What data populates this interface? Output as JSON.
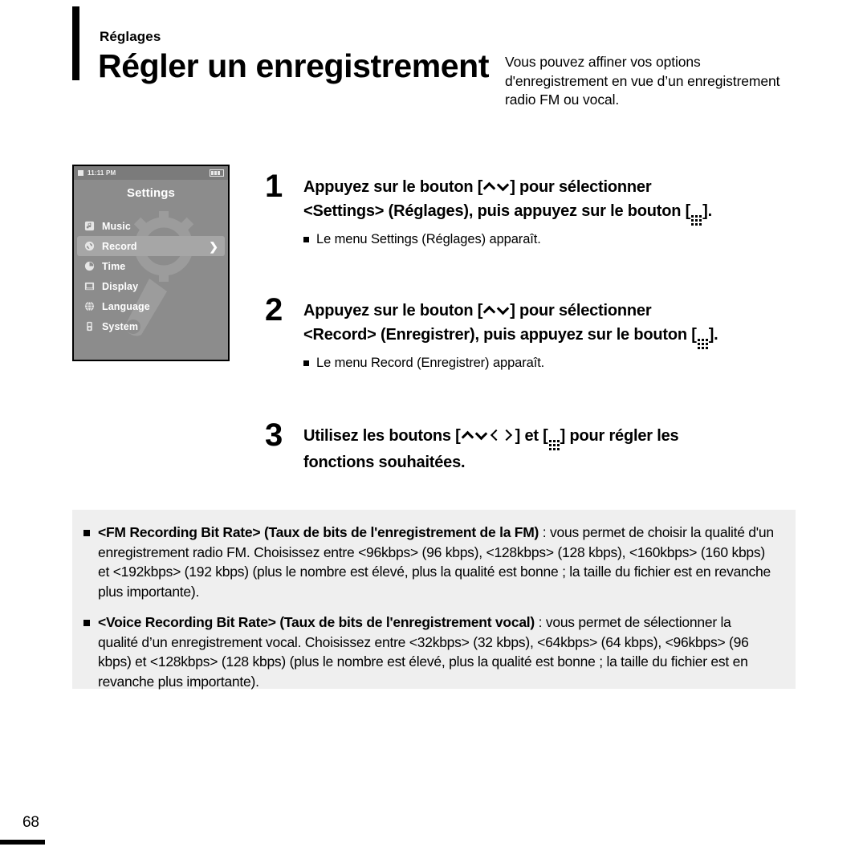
{
  "header": {
    "kicker": "Réglages",
    "title": "Régler un enregistrement",
    "description": "Vous pouvez affiner vos options d'enregistrement en vue d’un enregistrement radio FM ou vocal."
  },
  "device": {
    "status": {
      "time": "11:11 PM",
      "battery_icon": "battery-icon",
      "indicator_icon": "square-indicator-icon"
    },
    "title": "Settings",
    "menu": [
      {
        "label": "Music",
        "icon": "music-note-icon",
        "selected": false
      },
      {
        "label": "Record",
        "icon": "record-icon",
        "selected": true
      },
      {
        "label": "Time",
        "icon": "clock-icon",
        "selected": false
      },
      {
        "label": "Display",
        "icon": "display-icon",
        "selected": false
      },
      {
        "label": "Language",
        "icon": "globe-icon",
        "selected": false
      },
      {
        "label": "System",
        "icon": "device-icon",
        "selected": false
      }
    ],
    "chevron": "❯"
  },
  "steps": [
    {
      "number": "1",
      "line1_pre": "Appuyez sur le bouton [",
      "line1_post": "] pour sélectionner",
      "line2_pre": "<Settings> (Réglages), puis appuyez sur le bouton [",
      "line2_post": "].",
      "note": "Le menu Settings (Réglages) apparaît."
    },
    {
      "number": "2",
      "line1_pre": "Appuyez sur le bouton [",
      "line1_post": "] pour sélectionner",
      "line2_pre": "<Record> (Enregistrer), puis appuyez sur le bouton [",
      "line2_post": "].",
      "note": "Le menu Record (Enregistrer) apparaît."
    },
    {
      "number": "3",
      "line1_pre": "Utilisez les boutons [",
      "line1_mid": "] et [",
      "line1_post": "] pour régler les",
      "line2": "fonctions souhaitées."
    }
  ],
  "info": {
    "items": [
      {
        "term": "<FM Recording Bit Rate> (Taux de bits de l'enregistrement de la FM)",
        "body": " : vous permet de choisir la qualité d'un enregistrement radio FM. Choisissez entre <96kbps> (96 kbps), <128kbps> (128 kbps), <160kbps> (160 kbps) et <192kbps> (192 kbps) (plus le nombre est élevé, plus la qualité est bonne ; la taille du fichier est en revanche plus importante)."
      },
      {
        "term": "<Voice Recording Bit Rate> (Taux de bits de l'enregistrement vocal)",
        "body": " : vous permet de sélectionner la qualité d’un enregistrement vocal. Choisissez entre <32kbps> (32 kbps), <64kbps> (64 kbps), <96kbps> (96 kbps) et <128kbps> (128 kbps) (plus le nombre est élevé, plus la qualité est bonne ; la taille du fichier est en revanche plus importante)."
      }
    ]
  },
  "footer": {
    "page_number": "68"
  },
  "colors": {
    "device_bg": "#8c8c8c",
    "device_selected": "#a6a6a6",
    "info_box_bg": "#efefef",
    "ink": "#000000"
  }
}
